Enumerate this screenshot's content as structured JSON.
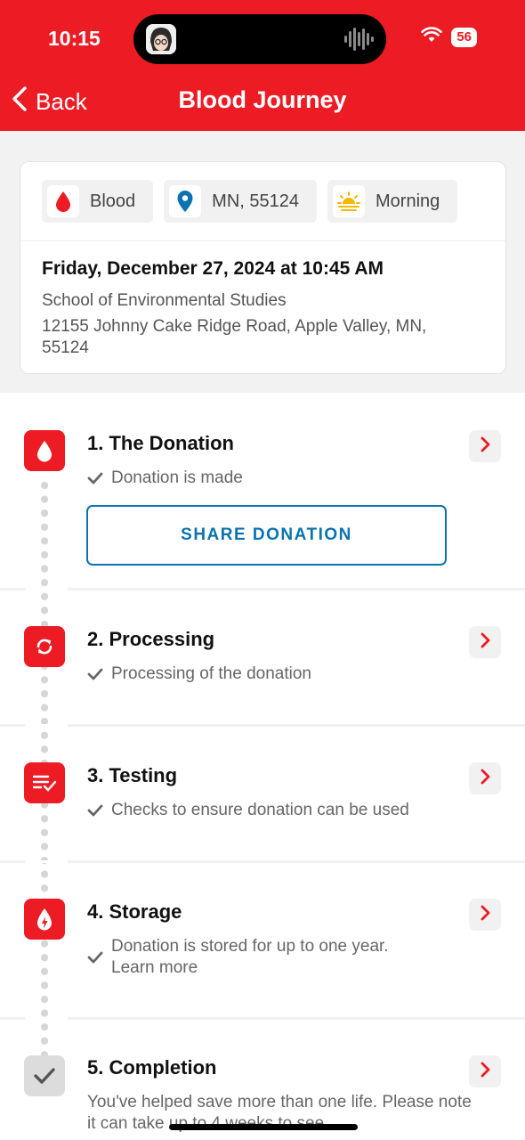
{
  "status_bar": {
    "time": "10:15",
    "battery": "56",
    "wifi_icon": "wifi-icon"
  },
  "nav": {
    "back_label": "Back",
    "title": "Blood Journey"
  },
  "colors": {
    "brand_red": "#ed1b24",
    "link_blue": "#0a73b0",
    "location_blue": "#0a73b0",
    "sun_yellow": "#f5b800"
  },
  "donation": {
    "chips": [
      {
        "icon": "blood-drop-icon",
        "label": "Blood"
      },
      {
        "icon": "location-pin-icon",
        "label": "MN, 55124"
      },
      {
        "icon": "sunrise-icon",
        "label": "Morning"
      }
    ],
    "date": "Friday, December 27, 2024 at 10:45 AM",
    "place": "School of Environmental Studies",
    "address": "12155 Johnny Cake Ridge Road, Apple Valley, MN, 55124"
  },
  "steps": [
    {
      "icon": "blood-drop-icon",
      "title": "1. The Donation",
      "status": "Donation is made",
      "action": "SHARE DONATION"
    },
    {
      "icon": "refresh-icon",
      "title": "2. Processing",
      "status": "Processing of the donation"
    },
    {
      "icon": "checklist-icon",
      "title": "3. Testing",
      "status": "Checks to ensure donation can be used"
    },
    {
      "icon": "drop-storage-icon",
      "title": "4. Storage",
      "status": "Donation is stored for up to one year. Learn more"
    },
    {
      "icon": "checkmark-icon",
      "title": "5. Completion",
      "status": "You've helped save more than one life. Please note it can take up to 4 weeks to see"
    }
  ]
}
